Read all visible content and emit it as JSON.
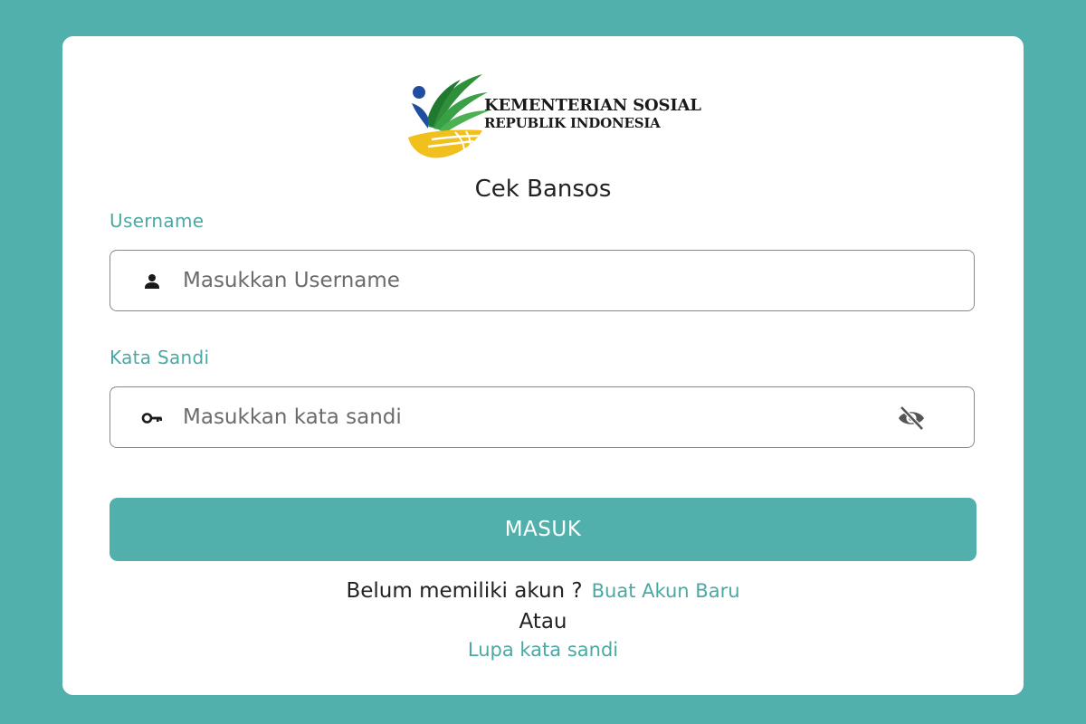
{
  "logo": {
    "line1": "KEMENTERIAN SOSIAL",
    "line2": "REPUBLIK INDONESIA"
  },
  "title": "Cek Bansos",
  "username": {
    "label": "Username",
    "placeholder": "Masukkan Username",
    "value": "",
    "icon": "person-icon"
  },
  "password": {
    "label": "Kata Sandi",
    "placeholder": "Masukkan kata sandi",
    "value": "",
    "icon": "key-icon",
    "toggle_icon": "eye-off-icon"
  },
  "submit_label": "MASUK",
  "register": {
    "prompt": "Belum memiliki akun ?",
    "link": "Buat Akun Baru"
  },
  "or_text": "Atau",
  "forgot_link": "Lupa kata sandi",
  "colors": {
    "background": "#52b0ac",
    "accent": "#4ba8a3",
    "card": "#ffffff"
  }
}
